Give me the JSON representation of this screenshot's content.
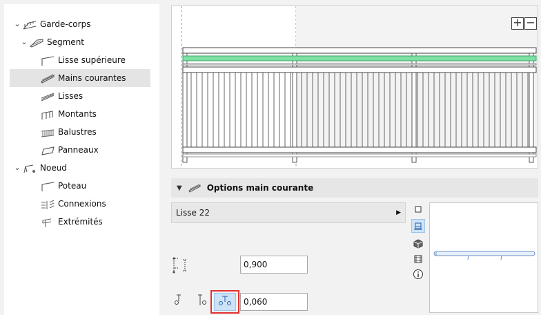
{
  "tree": {
    "root": {
      "label": "Garde-corps"
    },
    "segment": {
      "label": "Segment"
    },
    "segment_items": [
      {
        "label": "Lisse supérieure"
      },
      {
        "label": "Mains courantes"
      },
      {
        "label": "Lisses"
      },
      {
        "label": "Montants"
      },
      {
        "label": "Balustres"
      },
      {
        "label": "Panneaux"
      }
    ],
    "noeud": {
      "label": "Noeud"
    },
    "noeud_items": [
      {
        "label": "Poteau"
      },
      {
        "label": "Connexions"
      },
      {
        "label": "Extrémités"
      }
    ]
  },
  "preview": {
    "zoom_in_label": "+",
    "zoom_out_label": "−"
  },
  "options": {
    "title": "Options main courante",
    "profile_select": "Lisse 22",
    "height_value": "0,900",
    "offset_value": "0,060"
  },
  "colors": {
    "accent_highlight": "#e0312e",
    "handrail_green": "#7fe0a4",
    "selected_row": "#e4e4e4",
    "active_icon_bg": "#cfe3f7"
  },
  "icons": {
    "railing": "railing-icon",
    "segment": "segment-icon",
    "node": "node-icon"
  }
}
